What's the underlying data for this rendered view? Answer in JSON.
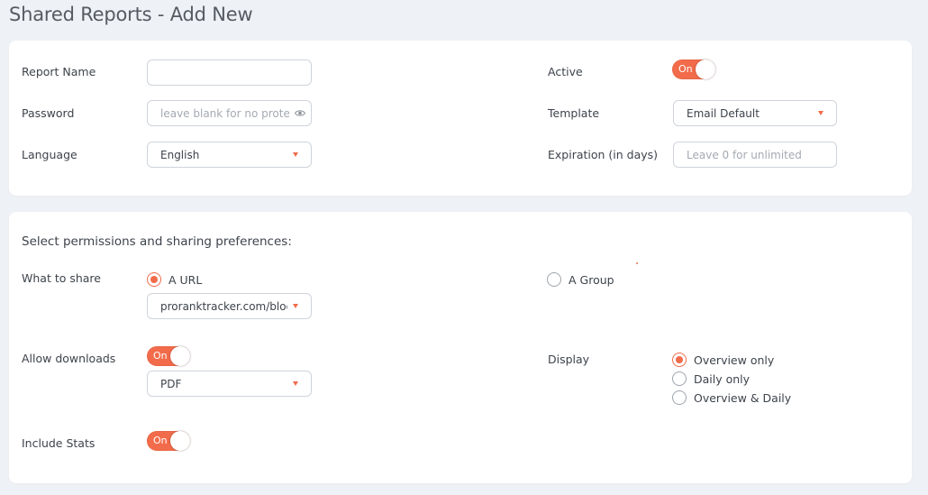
{
  "page": {
    "title": "Shared Reports - Add New"
  },
  "colors": {
    "accent": "#f26b4a",
    "page_bg": "#eef1f5",
    "card_bg": "#ffffff",
    "border": "#cfd4db"
  },
  "general": {
    "report_name": {
      "label": "Report Name",
      "value": ""
    },
    "password": {
      "label": "Password",
      "placeholder": "leave blank for no protection",
      "icon": "eye-icon"
    },
    "language": {
      "label": "Language",
      "value": "English"
    },
    "active": {
      "label": "Active",
      "toggle": "On",
      "state": true
    },
    "template": {
      "label": "Template",
      "value": "Email Default"
    },
    "expiration": {
      "label": "Expiration (in days)",
      "placeholder": "Leave 0 for unlimited"
    }
  },
  "permissions": {
    "title": "Select permissions and sharing preferences:",
    "what_to_share": {
      "label": "What to share",
      "options": [
        "A URL",
        "A Group"
      ],
      "selected": "A URL",
      "url_value": "proranktracker.com/blog/a"
    },
    "allow_downloads": {
      "label": "Allow downloads",
      "toggle": "On",
      "state": true,
      "format": "PDF"
    },
    "display": {
      "label": "Display",
      "options": [
        "Overview only",
        "Daily only",
        "Overview & Daily"
      ],
      "selected": "Overview only"
    },
    "include_stats": {
      "label": "Include Stats",
      "toggle": "On",
      "state": true
    }
  }
}
